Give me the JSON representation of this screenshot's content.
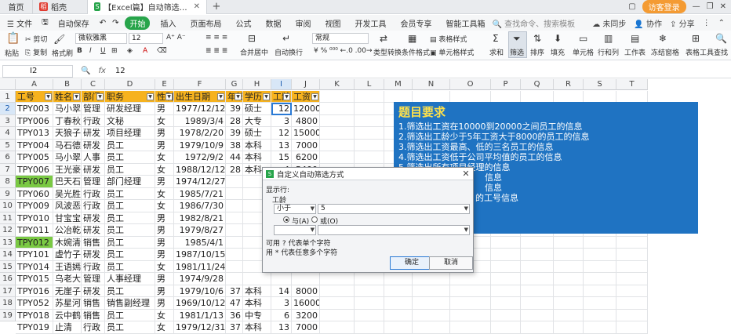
{
  "titlebar": {
    "home_tab": "首页",
    "tab2": "稻壳",
    "active_tab": "【Excel篇】自动筛选和高级筛选",
    "login_label": "访客登录",
    "new_tab_symbol": "+"
  },
  "menubar": {
    "file": "文件",
    "autosave": "自动保存",
    "start": "开始",
    "items": [
      "插入",
      "页面布局",
      "公式",
      "数据",
      "审阅",
      "视图",
      "开发工具",
      "会员专享",
      "智能工具箱"
    ],
    "search_placeholder": "查找命令、搜索模板",
    "collab": "未同步",
    "cooperate": "协作",
    "share": "分享"
  },
  "ribbon": {
    "paste": "粘贴",
    "cut": "剪切",
    "copy": "复制",
    "format_painter": "格式刷",
    "font_name": "微软雅黑",
    "font_size": "12",
    "merge_center": "合并居中",
    "wrap": "自动换行",
    "number_format": "常规",
    "type_convert": "类型转换",
    "cond_format": "条件格式",
    "table_style": "表格样式",
    "cell_style": "单元格样式",
    "sum": "求和",
    "filter": "筛选",
    "sort": "排序",
    "fill": "填充",
    "cell": "单元格",
    "row_col": "行和列",
    "worksheet": "工作表",
    "freeze": "冻结窗格",
    "table_tools": "表格工具",
    "find": "查找"
  },
  "formulabar": {
    "cell_ref": "I2",
    "fx": "fx",
    "value": "12"
  },
  "columns": [
    "A",
    "B",
    "C",
    "D",
    "E",
    "F",
    "G",
    "H",
    "I",
    "J",
    "K",
    "L",
    "M",
    "N",
    "O",
    "P",
    "Q",
    "R",
    "S",
    "T"
  ],
  "rows": [
    "1",
    "2",
    "3",
    "4",
    "5",
    "6",
    "7",
    "8",
    "9",
    "10",
    "11",
    "12",
    "13",
    "14",
    "15",
    "16",
    "17",
    "18",
    "19"
  ],
  "table": {
    "headers": [
      "工号",
      "姓名",
      "部门",
      "职务",
      "性别",
      "出生日期",
      "年龄",
      "学历",
      "工龄",
      "工资"
    ],
    "rows": [
      [
        "TPY003",
        "马小翠",
        "管理",
        "研发经理",
        "男",
        "1977/12/12",
        "39",
        "硕士",
        "12",
        "12000"
      ],
      [
        "TPY006",
        "丁春秋",
        "行政",
        "文秘",
        "女",
        "1989/3/4",
        "28",
        "大专",
        "3",
        "4800"
      ],
      [
        "TPY013",
        "天狼子",
        "研发",
        "项目经理",
        "男",
        "1978/2/20",
        "39",
        "硕士",
        "12",
        "15000"
      ],
      [
        "TPY004",
        "马石德",
        "研发",
        "员工",
        "男",
        "1979/10/9",
        "38",
        "本科",
        "13",
        "7000"
      ],
      [
        "TPY005",
        "马小翠",
        "人事",
        "员工",
        "女",
        "1972/9/2",
        "44",
        "本科",
        "15",
        "6200"
      ],
      [
        "TPY006",
        "王光豪",
        "研发",
        "员工",
        "女",
        "1988/12/12",
        "28",
        "本科",
        "4",
        "5400"
      ],
      [
        "TPY007",
        "巴天石",
        "管理",
        "部门经理",
        "男",
        "1974/12/27",
        "",
        "",
        "",
        ""
      ],
      [
        "TPY060",
        "吴光胜",
        "行政",
        "员工",
        "女",
        "1985/7/21",
        "",
        "",
        "",
        ""
      ],
      [
        "TPY009",
        "风波恶",
        "行政",
        "员工",
        "女",
        "1986/7/30",
        "",
        "",
        "",
        ""
      ],
      [
        "TPY010",
        "甘宝宝",
        "研发",
        "员工",
        "男",
        "1982/8/21",
        "",
        "",
        "",
        ""
      ],
      [
        "TPY011",
        "公冶乾",
        "研发",
        "员工",
        "男",
        "1979/8/27",
        "",
        "",
        "",
        ""
      ],
      [
        "TPY012",
        "木婉清",
        "销售",
        "员工",
        "男",
        "1985/4/1",
        "",
        "",
        "",
        ""
      ],
      [
        "TPY101",
        "虚竹子",
        "研发",
        "员工",
        "男",
        "1987/10/15",
        "",
        "",
        "",
        ""
      ],
      [
        "TPY014",
        "王语嫣",
        "行政",
        "员工",
        "女",
        "1981/11/24",
        "",
        "",
        "",
        ""
      ],
      [
        "TPY015",
        "乌老大",
        "管理",
        "人事经理",
        "男",
        "1974/9/28",
        "",
        "",
        "",
        ""
      ],
      [
        "TPY016",
        "无崖子",
        "研发",
        "员工",
        "男",
        "1979/10/6",
        "37",
        "本科",
        "14",
        "8000"
      ],
      [
        "TPY052",
        "苏星河",
        "销售",
        "销售副经理",
        "男",
        "1969/10/12",
        "47",
        "本科",
        "3",
        "16000"
      ],
      [
        "TPY018",
        "云中鹤",
        "销售",
        "员工",
        "女",
        "1981/1/13",
        "36",
        "中专",
        "6",
        "3200"
      ],
      [
        "TPY019",
        "止清",
        "行政",
        "员工",
        "女",
        "1979/12/31",
        "37",
        "本科",
        "13",
        "7000"
      ]
    ]
  },
  "question": {
    "title": "题目要求",
    "lines": [
      "1.筛选出工资在10000到20000之间员工的信息",
      "2.筛选出工龄少于5年工资大于8000的员工的信息",
      "3.筛选出工资最高、低的三名员工的信息",
      "4.筛选出工资低于公司平均值的员工的信息",
      "5.筛选出所有项目经理的信息",
      "信息",
      "信息",
      "的工号信息"
    ]
  },
  "dialog": {
    "title": "自定义自动筛选方式",
    "show_rows": "显示行:",
    "field": "工龄",
    "operator1": "小于",
    "value1": "5",
    "and_label": "与(A)",
    "or_label": "或(O)",
    "operator2": "",
    "value2": "",
    "hint1": "可用 ? 代表单个字符",
    "hint2": "用 * 代表任意多个字符",
    "ok": "确定",
    "cancel": "取消"
  },
  "colors": {
    "header_fill": "#f6b21e",
    "highlight_green": "#7ac943",
    "question_box": "#1f73c2",
    "question_title": "#ffe14a",
    "wps_green": "#27a44a"
  }
}
